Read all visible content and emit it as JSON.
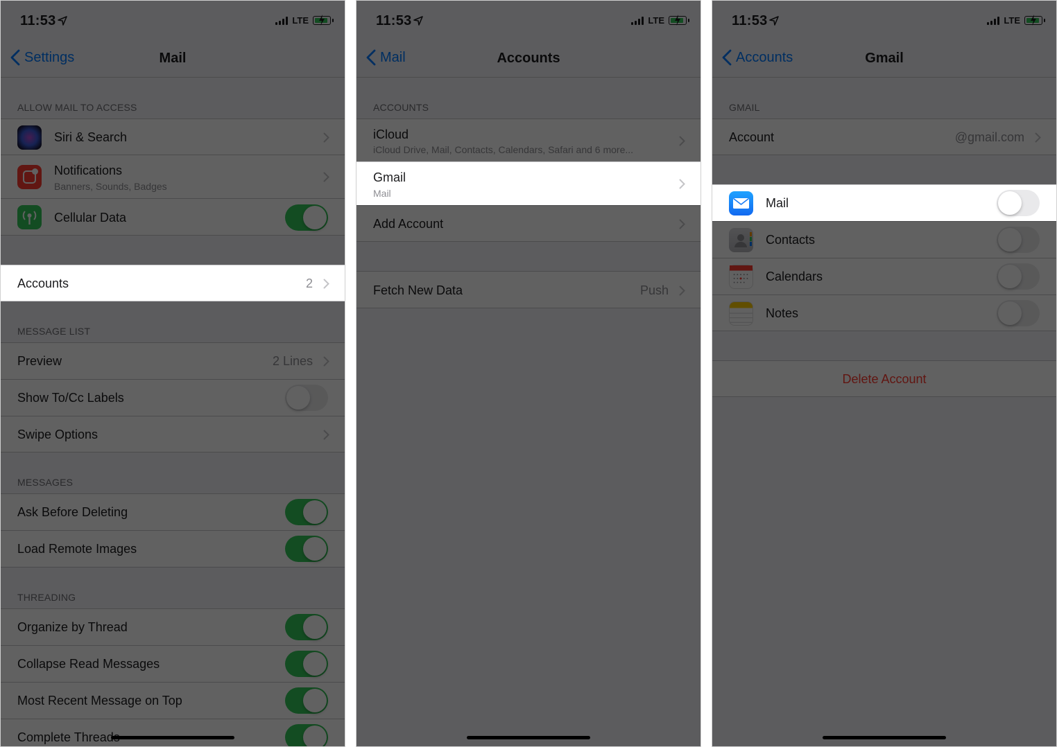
{
  "status": {
    "time": "11:53",
    "network": "LTE"
  },
  "panel1": {
    "back_label": "Settings",
    "title": "Mail",
    "sections": {
      "allow": "ALLOW MAIL TO ACCESS",
      "message_list": "MESSAGE LIST",
      "messages": "MESSAGES",
      "threading": "THREADING"
    },
    "rows": {
      "siri": "Siri & Search",
      "notifications": "Notifications",
      "notifications_sub": "Banners, Sounds, Badges",
      "cellular": "Cellular Data",
      "accounts": "Accounts",
      "accounts_count": "2",
      "preview": "Preview",
      "preview_value": "2 Lines",
      "show_tocc": "Show To/Cc Labels",
      "swipe": "Swipe Options",
      "ask_delete": "Ask Before Deleting",
      "load_images": "Load Remote Images",
      "organize": "Organize by Thread",
      "collapse": "Collapse Read Messages",
      "recent_top": "Most Recent Message on Top",
      "complete": "Complete Threads"
    },
    "toggles": {
      "cellular": true,
      "show_tocc": false,
      "ask_delete": true,
      "load_images": true,
      "organize": true,
      "collapse": true,
      "recent_top": true,
      "complete": true
    }
  },
  "panel2": {
    "back_label": "Mail",
    "title": "Accounts",
    "section": "ACCOUNTS",
    "icloud": "iCloud",
    "icloud_sub": "iCloud Drive, Mail, Contacts, Calendars, Safari and 6 more...",
    "gmail": "Gmail",
    "gmail_sub": "Mail",
    "add_account": "Add Account",
    "fetch": "Fetch New Data",
    "fetch_value": "Push"
  },
  "panel3": {
    "back_label": "Accounts",
    "title": "Gmail",
    "section": "GMAIL",
    "account": "Account",
    "account_value": "@gmail.com",
    "mail": "Mail",
    "contacts": "Contacts",
    "calendars": "Calendars",
    "notes": "Notes",
    "delete": "Delete Account",
    "toggles": {
      "mail": false,
      "contacts": false,
      "calendars": false,
      "notes": false
    }
  },
  "colors": {
    "accent": "#007aff",
    "toggle_on": "#34c759",
    "destructive": "#ff3b30",
    "overlay": "rgba(0,0,0,0.62)"
  },
  "icons": [
    "location-arrow-icon",
    "signal-icon",
    "battery-icon",
    "back-chevron-icon",
    "siri-icon",
    "notifications-icon",
    "cellular-icon",
    "mail-app-icon",
    "contacts-app-icon",
    "calendar-app-icon",
    "notes-app-icon",
    "chevron-right-icon"
  ]
}
